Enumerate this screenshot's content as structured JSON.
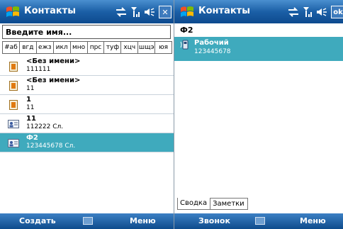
{
  "left": {
    "title": "Контакты",
    "status_icons": [
      "sync-icon",
      "signal-icon",
      "volume-icon"
    ],
    "close_label": "✕",
    "search_placeholder": "Введите имя...",
    "alpha_tabs": [
      "#аб",
      "вгд",
      "ежз",
      "икл",
      "мно",
      "прс",
      "туф",
      "хцч",
      "шщэ",
      "юя"
    ],
    "contacts": [
      {
        "name": "<Без имени>",
        "sub": "111111",
        "icon": "contact-card-icon",
        "selected": false
      },
      {
        "name": "<Без имени>",
        "sub": "11",
        "icon": "contact-card-icon",
        "selected": false
      },
      {
        "name": "1",
        "sub": "11",
        "icon": "contact-card-icon",
        "selected": false
      },
      {
        "name": "11",
        "sub": "112222  Сл.",
        "icon": "sim-contact-icon",
        "selected": false
      },
      {
        "name": "Ф2",
        "sub": "123445678  Сл.",
        "icon": "sim-contact-icon",
        "selected": true
      }
    ],
    "softkeys": {
      "left": "Создать",
      "right": "Меню"
    }
  },
  "right": {
    "title": "Контакты",
    "ok_label": "ok",
    "contact_name": "Ф2",
    "phone_label": "Рабочий",
    "phone_number": "123445678",
    "tabs": [
      "Сводка",
      "Заметки"
    ],
    "softkeys": {
      "left": "Звонок",
      "right": "Меню"
    }
  },
  "colors": {
    "selection": "#3faabd",
    "titlebar": "#1b5fa6"
  }
}
